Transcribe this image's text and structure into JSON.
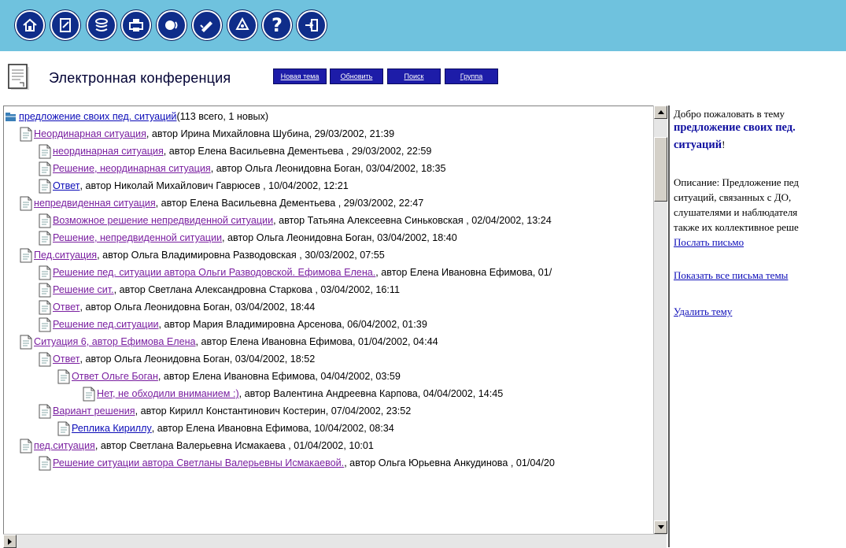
{
  "toolbar": {
    "icons": [
      "home-icon",
      "edit-document-icon",
      "stack-icon",
      "printer-icon",
      "speaker-icon",
      "pencil-check-icon",
      "recycle-icon",
      "help-icon",
      "exit-icon"
    ],
    "help_glyph": "?"
  },
  "header": {
    "title": "Электронная конференция",
    "buttons": {
      "new_topic": "Новая тема",
      "refresh": "Обновить",
      "search": "Поиск",
      "group": "Группа"
    }
  },
  "tree": {
    "root": {
      "title": "предложение своих пед. ситуаций",
      "suffix": " (113 всего, 1 новых)"
    },
    "rows": [
      {
        "title": "Неординарная ситуация",
        "meta": ", автор Ирина Михайловна Шубина, 29/03/2002, 21:39"
      },
      {
        "title": "неординарная ситуация",
        "meta": ", автор Елена Васильевна Дементьева , 29/03/2002, 22:59"
      },
      {
        "title": "Решение, неординарная ситуация",
        "meta": ", автор Ольга Леонидовна Боган, 03/04/2002, 18:35"
      },
      {
        "title": "Ответ",
        "meta": ", автор Николай Михайлович Гаврюсев , 10/04/2002, 12:21"
      },
      {
        "title": "непредвиденная ситуация",
        "meta": ", автор Елена Васильевна Дементьева , 29/03/2002, 22:47"
      },
      {
        "title": "Возможное решение непредвиденной ситуации",
        "meta": ", автор Татьяна Алексеевна Синьковская , 02/04/2002, 13:24"
      },
      {
        "title": "Решение, непредвиденной ситуации",
        "meta": ", автор Ольга Леонидовна Боган, 03/04/2002, 18:40"
      },
      {
        "title": "Пед.ситуация",
        "meta": ", автор Ольга Владимировна Разводовская , 30/03/2002, 07:55"
      },
      {
        "title": "Решение пед. ситуации автора Ольги Разводовской. Ефимова Елена.",
        "meta": ", автор Елена Ивановна Ефимова, 01/"
      },
      {
        "title": "Решение сит.",
        "meta": ", автор Светлана Александровна Старкова , 03/04/2002, 16:11"
      },
      {
        "title": "Ответ",
        "meta": ", автор Ольга Леонидовна Боган, 03/04/2002, 18:44"
      },
      {
        "title": "Решение пед.ситуации",
        "meta": ", автор Мария Владимировна Арсенова, 06/04/2002, 01:39"
      },
      {
        "title": "Ситуация 6, автор Ефимова Елена",
        "meta": ", автор Елена Ивановна Ефимова, 01/04/2002, 04:44"
      },
      {
        "title": "Ответ",
        "meta": ", автор Ольга Леонидовна Боган, 03/04/2002, 18:52"
      },
      {
        "title": "Ответ Ольге Боган",
        "meta": ", автор Елена Ивановна Ефимова, 04/04/2002, 03:59"
      },
      {
        "title": "Нет, не обходили вниманием :)",
        "meta": ", автор Валентина Андреевна Карпова, 04/04/2002, 14:45"
      },
      {
        "title": "Вариант решения",
        "meta": ", автор Кирилл Константинович Костерин, 07/04/2002, 23:52"
      },
      {
        "title": "Реплика Кириллу",
        "meta": ", автор Елена Ивановна Ефимова, 10/04/2002, 08:34"
      },
      {
        "title": "пед.ситуация",
        "meta": ", автор Светлана Валерьевна Исмакаева , 01/04/2002, 10:01"
      },
      {
        "title": "Решение ситуации автора Светланы Валерьевны Исмакаевой.",
        "meta": ", автор Ольга Юрьевна Анкудинова , 01/04/20"
      }
    ]
  },
  "right": {
    "welcome": "Добро пожаловать в тему",
    "topic_line1": "предложение своих пед.",
    "topic_line2": "ситуаций",
    "topic_end": "!",
    "desc1": "Описание: Предложение пед",
    "desc2": "ситуаций, связанных с ДО,",
    "desc3": "слушателями и наблюдателя",
    "desc4": "также их коллективное реше",
    "send_mail": "Послать письмо",
    "show_all": "Показать все письма темы",
    "delete_topic": "Удалить тему"
  }
}
